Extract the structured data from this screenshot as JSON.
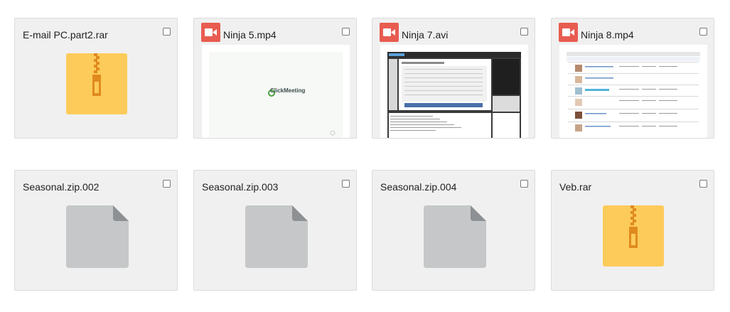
{
  "files": [
    {
      "name": "E-mail PC.part2.rar",
      "type": "archive",
      "icon": "zip-icon"
    },
    {
      "name": "Ninja 5.mp4",
      "type": "video",
      "icon": "video-camera-icon",
      "thumbnail_text": "ClickMeeting"
    },
    {
      "name": "Ninja 7.avi",
      "type": "video",
      "icon": "video-camera-icon"
    },
    {
      "name": "Ninja 8.mp4",
      "type": "video",
      "icon": "video-camera-icon"
    },
    {
      "name": "Seasonal.zip.002",
      "type": "file",
      "icon": "generic-file-icon"
    },
    {
      "name": "Seasonal.zip.003",
      "type": "file",
      "icon": "generic-file-icon"
    },
    {
      "name": "Seasonal.zip.004",
      "type": "file",
      "icon": "generic-file-icon"
    },
    {
      "name": "Veb.rar",
      "type": "archive",
      "icon": "zip-icon"
    }
  ],
  "colors": {
    "card_background": "#f0f0f0",
    "card_border": "#dcdcdc",
    "archive_yellow": "#fdcb5a",
    "zipper_orange": "#e08a1e",
    "video_badge_red": "#e85c50",
    "generic_file_gray": "#c5c7c8"
  }
}
